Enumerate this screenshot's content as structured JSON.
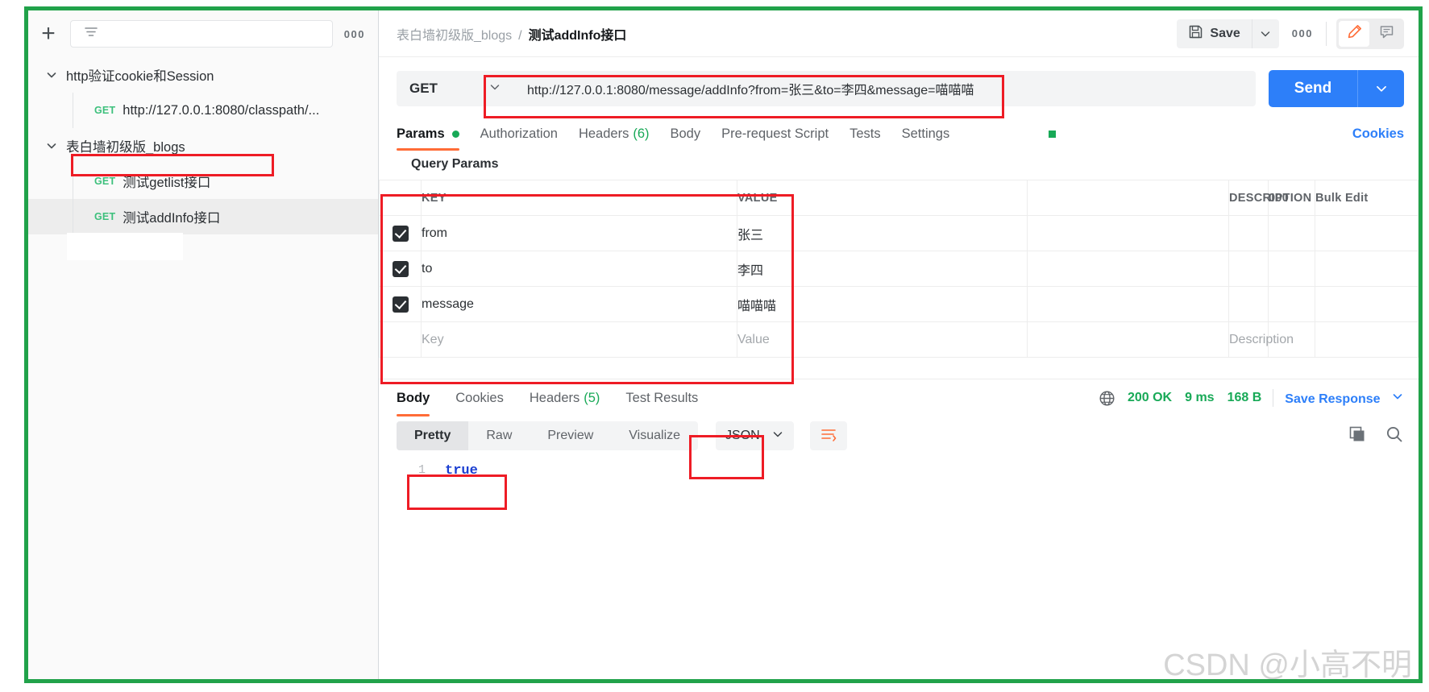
{
  "sidebar": {
    "new_button": "+",
    "filter_placeholder": "",
    "more_label": "000",
    "collections": [
      {
        "name": "http验证cookie和Session",
        "requests": [
          {
            "method": "GET",
            "label": "http://127.0.0.1:8080/classpath/..."
          }
        ]
      },
      {
        "name": "表白墙初级版_blogs",
        "requests": [
          {
            "method": "GET",
            "label": "测试getlist接口"
          },
          {
            "method": "GET",
            "label": "测试addInfo接口"
          }
        ]
      }
    ]
  },
  "topbar": {
    "breadcrumb_parent": "表白墙初级版_blogs",
    "breadcrumb_sep": "/",
    "breadcrumb_current": "测试addInfo接口",
    "save_label": "Save",
    "save_caret": "⌄",
    "more_label": "000",
    "edit_icon_name": "pencil-icon",
    "comment_icon_name": "comment-icon"
  },
  "request": {
    "method": "GET",
    "method_caret": "⌄",
    "url": "http://127.0.0.1:8080/message/addInfo?from=张三&to=李四&message=喵喵喵",
    "send_label": "Send",
    "send_caret": "⌄",
    "tabs": [
      {
        "label": "Params",
        "badge": "dot",
        "active": true
      },
      {
        "label": "Authorization",
        "badge": "",
        "active": false
      },
      {
        "label": "Headers",
        "count": "(6)",
        "active": false
      },
      {
        "label": "Body",
        "badge": "",
        "active": false
      },
      {
        "label": "Pre-request Script",
        "badge": "",
        "active": false
      },
      {
        "label": "Tests",
        "badge": "",
        "active": false
      },
      {
        "label": "Settings",
        "badge": "",
        "active": false
      }
    ],
    "cookies_link": "Cookies"
  },
  "query_params": {
    "section_title": "Query Params",
    "headers": {
      "key": "KEY",
      "value": "VALUE",
      "description": "DESCRIPTION",
      "dots": "000",
      "bulk_edit": "Bulk Edit"
    },
    "rows": [
      {
        "checked": true,
        "key": "from",
        "value": "张三",
        "description": ""
      },
      {
        "checked": true,
        "key": "to",
        "value": "李四",
        "description": ""
      },
      {
        "checked": true,
        "key": "message",
        "value": "喵喵喵",
        "description": ""
      }
    ],
    "placeholder_row": {
      "key": "Key",
      "value": "Value",
      "description": "Description"
    }
  },
  "response": {
    "tabs": [
      {
        "label": "Body",
        "active": true
      },
      {
        "label": "Cookies",
        "active": false
      },
      {
        "label": "Headers",
        "count": "(5)",
        "active": false
      },
      {
        "label": "Test Results",
        "active": false
      }
    ],
    "status": "200 OK",
    "time": "9 ms",
    "size": "168 B",
    "save_response": "Save Response",
    "save_response_caret": "⌄",
    "view_modes": [
      {
        "label": "Pretty",
        "active": true
      },
      {
        "label": "Raw",
        "active": false
      },
      {
        "label": "Preview",
        "active": false
      },
      {
        "label": "Visualize",
        "active": false
      }
    ],
    "format": "JSON",
    "format_caret": "⌄",
    "body_line_number": "1",
    "body_text": "true"
  },
  "watermark": "CSDN @小高不明",
  "colors": {
    "accent_orange": "#ff6c37",
    "link_blue": "#2d7ff9",
    "success_green": "#18a957",
    "method_get_green": "#3dc07c",
    "annotation_red": "#ee1c25",
    "frame_green": "#21a24a"
  }
}
